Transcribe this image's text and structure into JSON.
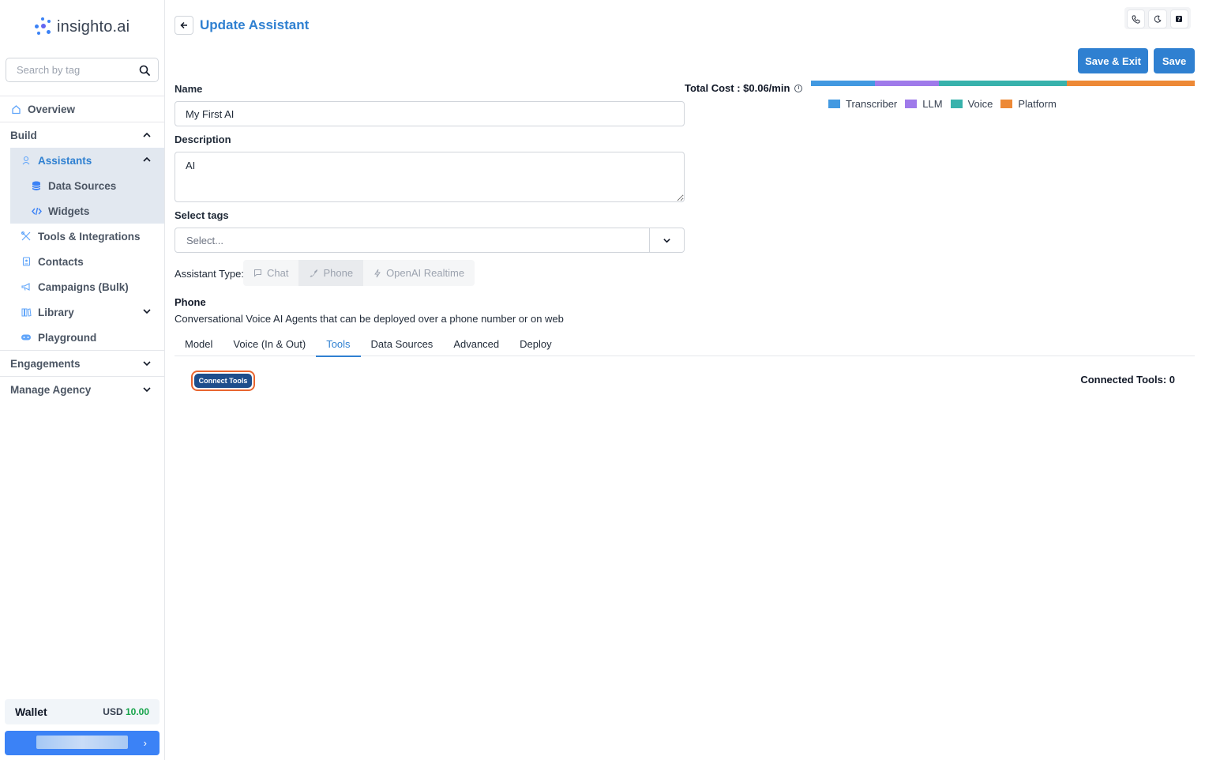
{
  "app": {
    "logo_text": "insighto.ai"
  },
  "sidebar": {
    "search_placeholder": "Search by tag",
    "overview": "Overview",
    "build": "Build",
    "assistants": "Assistants",
    "data_sources": "Data Sources",
    "widgets": "Widgets",
    "tools_integrations": "Tools & Integrations",
    "contacts": "Contacts",
    "campaigns": "Campaigns (Bulk)",
    "library": "Library",
    "playground": "Playground",
    "engagements": "Engagements",
    "manage_agency": "Manage Agency",
    "wallet_label": "Wallet",
    "wallet_currency": "USD",
    "wallet_amount": "10.00"
  },
  "header": {
    "title": "Update Assistant",
    "save_exit": "Save & Exit",
    "save": "Save"
  },
  "form": {
    "name_label": "Name",
    "name_value": "My First AI",
    "description_label": "Description",
    "description_value": "AI",
    "tags_label": "Select tags",
    "tags_placeholder": "Select...",
    "assistant_type_label": "Assistant Type:",
    "assistant_types": [
      "Chat",
      "Phone",
      "OpenAI Realtime"
    ],
    "selected_type": "Phone"
  },
  "phone": {
    "heading": "Phone",
    "description": "Conversational Voice AI Agents that can be deployed over a phone number or on web"
  },
  "tabs": [
    "Model",
    "Voice (In & Out)",
    "Tools",
    "Data Sources",
    "Advanced",
    "Deploy"
  ],
  "active_tab": "Tools",
  "tools": {
    "connect_label": "Connect Tools",
    "connected_label": "Connected Tools: 0"
  },
  "cost": {
    "total_label": "Total Cost : $0.06/min",
    "segments": [
      {
        "name": "Transcriber",
        "color": "#4299e1",
        "share": 0.1667
      },
      {
        "name": "LLM",
        "color": "#9f7aea",
        "share": 0.1667
      },
      {
        "name": "Voice",
        "color": "#38b2ac",
        "share": 0.3333
      },
      {
        "name": "Platform",
        "color": "#ed8936",
        "share": 0.3333
      }
    ]
  }
}
